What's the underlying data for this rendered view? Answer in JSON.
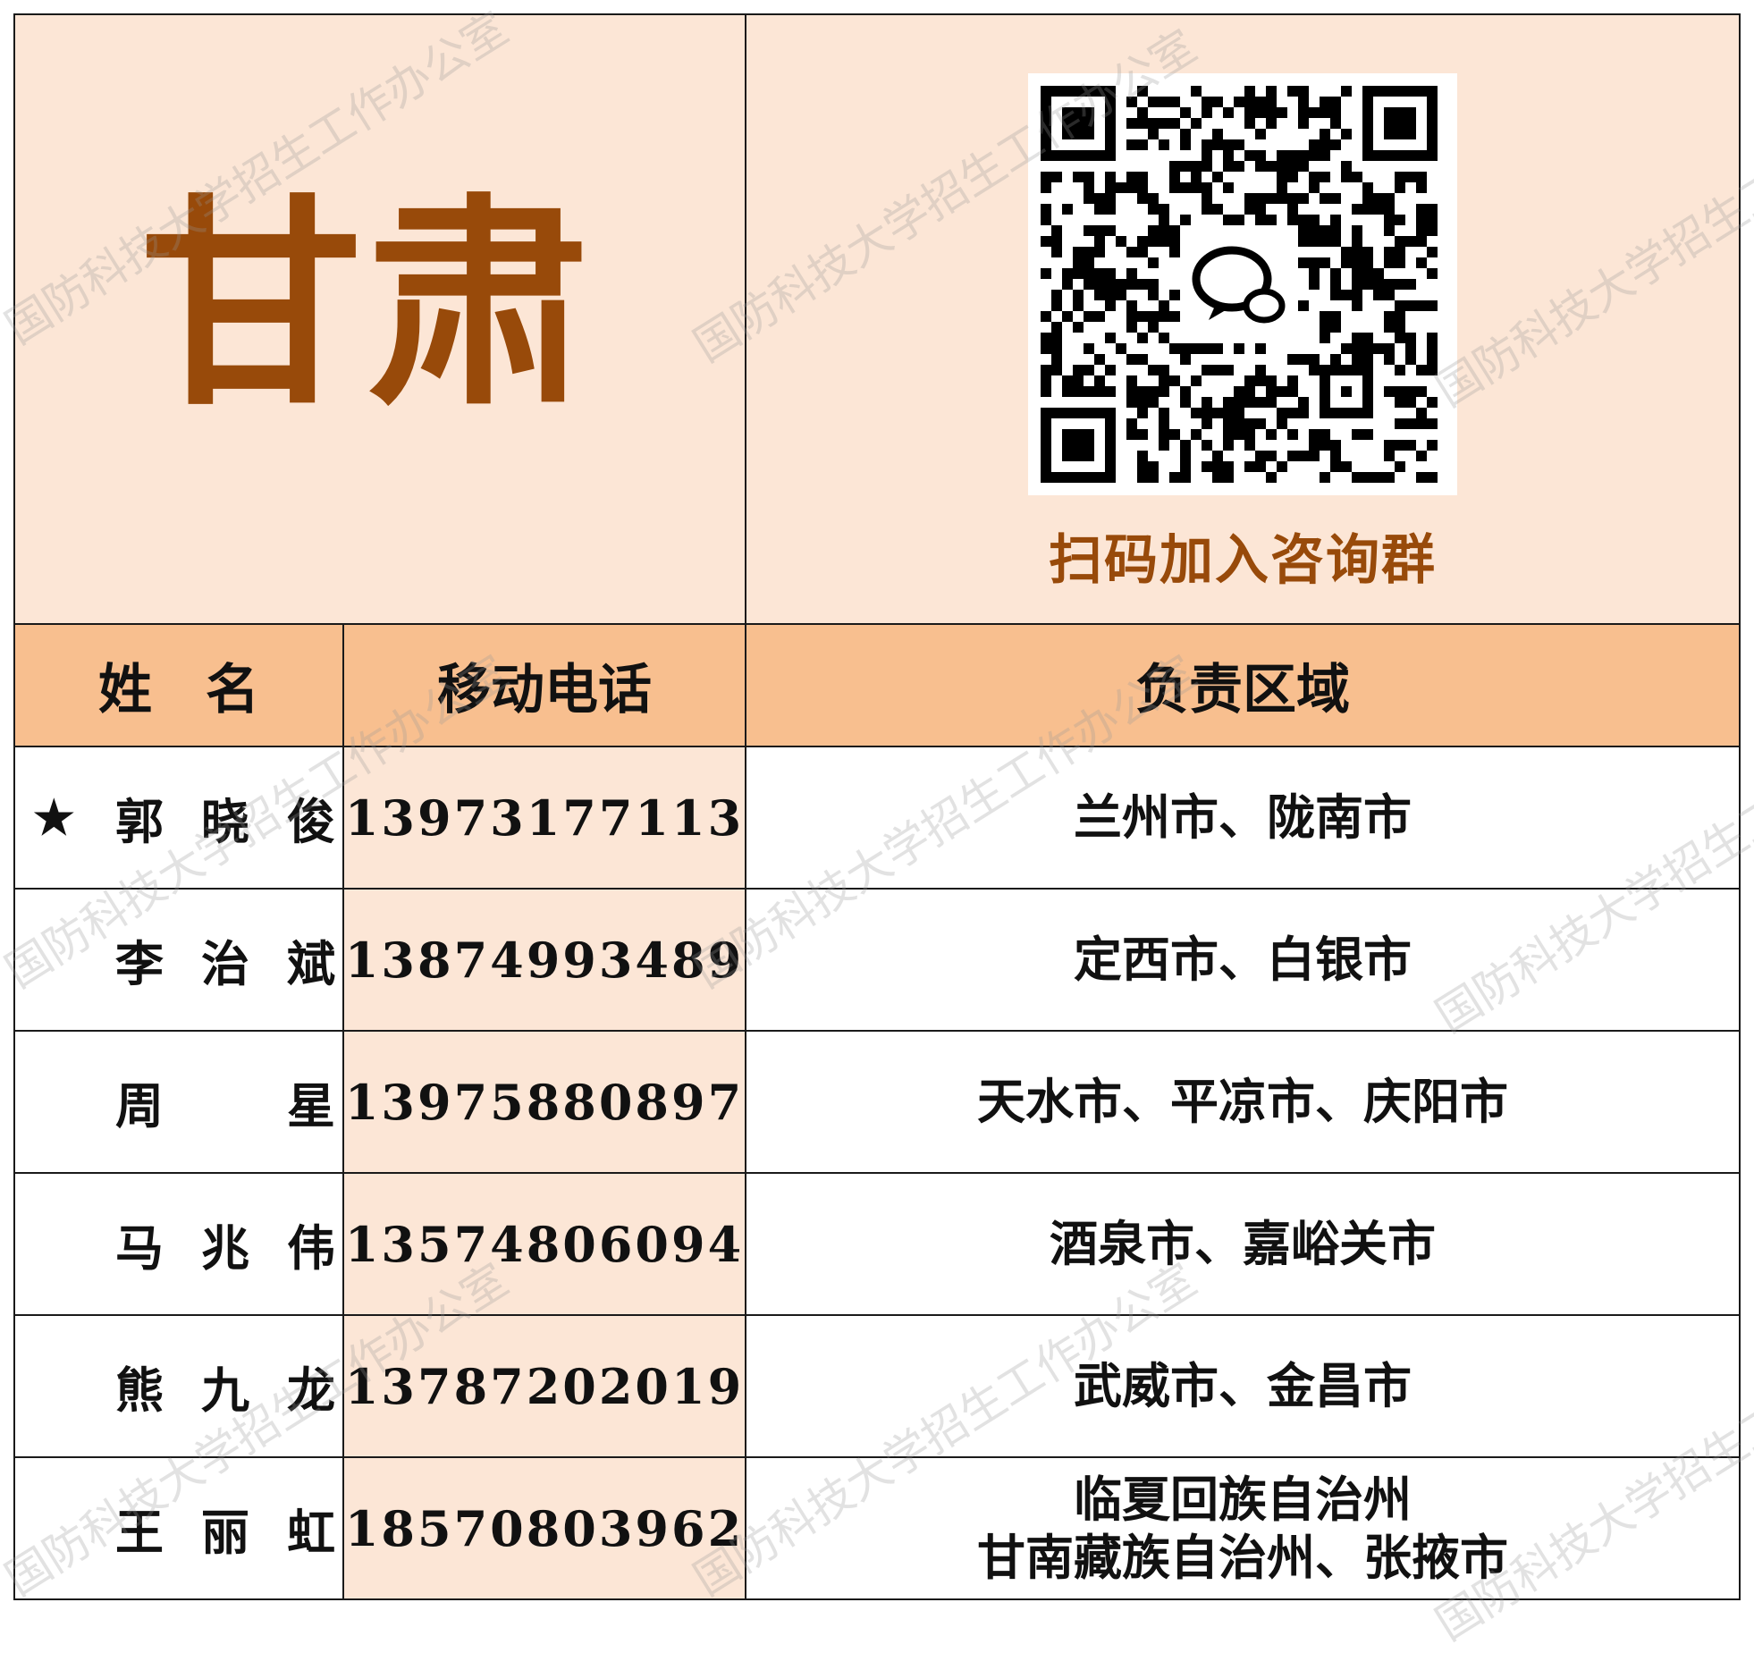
{
  "province": "甘肃",
  "qr": {
    "caption": "扫码加入咨询群",
    "icon": "wechat-chat-icon"
  },
  "headers": {
    "name": "姓　名",
    "phone": "移动电话",
    "region": "负责区域"
  },
  "contacts": [
    {
      "star": "★",
      "name_chars": [
        "郭",
        "晓",
        "俊"
      ],
      "phone": "13973177113",
      "region": [
        "兰州市、陇南市"
      ]
    },
    {
      "star": "",
      "name_chars": [
        "李",
        "治",
        "斌"
      ],
      "phone": "13874993489",
      "region": [
        "定西市、白银市"
      ]
    },
    {
      "star": "",
      "name_chars": [
        "周",
        "星"
      ],
      "phone": "13975880897",
      "region": [
        "天水市、平凉市、庆阳市"
      ]
    },
    {
      "star": "",
      "name_chars": [
        "马",
        "兆",
        "伟"
      ],
      "phone": "13574806094",
      "region": [
        "酒泉市、嘉峪关市"
      ]
    },
    {
      "star": "",
      "name_chars": [
        "熊",
        "九",
        "龙"
      ],
      "phone": "13787202019",
      "region": [
        "武威市、金昌市"
      ]
    },
    {
      "star": "",
      "name_chars": [
        "王",
        "丽",
        "虹"
      ],
      "phone": "18570803962",
      "region": [
        "临夏回族自治州",
        "甘南藏族自治州、张掖市"
      ]
    }
  ],
  "watermark": "国防科技大学招生工作办公室",
  "colors": {
    "accent": "#984a0a",
    "light_bg": "#fce6d6",
    "header_bg": "#f8bf8f"
  }
}
